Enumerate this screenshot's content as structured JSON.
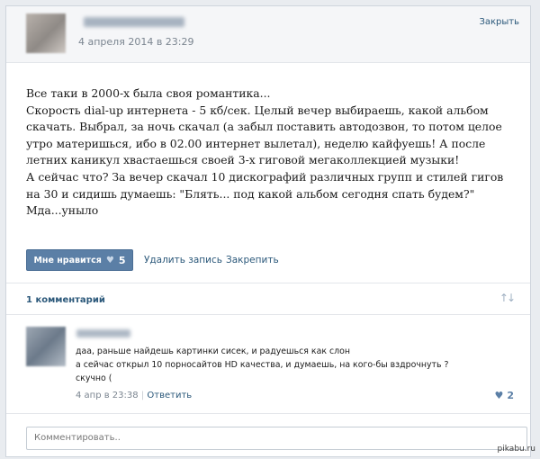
{
  "header": {
    "date": "4 апреля 2014 в 23:29",
    "close_label": "Закрыть"
  },
  "post": {
    "lines": [
      "Все таки в 2000-х была своя романтика...",
      "Скорость dial-up интернета - 5 кб/сек. Целый вечер выбираешь, какой альбом",
      "скачать. Выбрал, за ночь скачал (а забыл поставить автодозвон, то потом целое",
      "утро материшься, ибо в 02.00 интернет вылетал), неделю кайфуешь! А после",
      "летних каникул хвастаешься своей 3-х гиговой мегаколлекцией музыки!",
      "А сейчас что? За вечер скачал 10 дискографий различных групп и стилей гигов",
      "на 30 и сидишь думаешь: \"Блять... под какой альбом сегодня спать будем?\"",
      "Мда...уныло"
    ]
  },
  "actions": {
    "like_label": "Мне нравится",
    "like_icon": "heart-icon",
    "like_count": "5",
    "delete_label": "Удалить запись",
    "pin_label": "Закрепить"
  },
  "comments": {
    "count_label": "1 комментарий",
    "sort_icon": "sort-arrows-icon",
    "items": [
      {
        "lines": [
          "даа, раньше найдешь картинки сисек, и радуешься как слон",
          "а сейчас открыл 10 порносайтов HD качества, и думаешь, на кого-бы вздрочнуть ?",
          "скучно ("
        ],
        "date": "4 апр в 23:38",
        "separator": "|",
        "reply_label": "Ответить",
        "likes": "2"
      }
    ],
    "input_placeholder": "Комментировать.."
  },
  "watermark": "pikabu.ru"
}
